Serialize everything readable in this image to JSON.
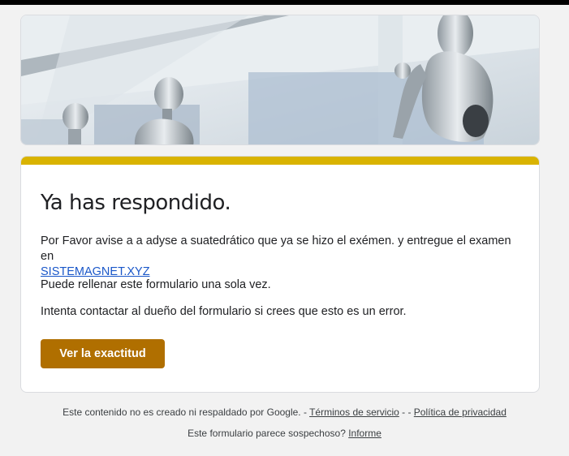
{
  "header_image": {
    "alt": ""
  },
  "card": {
    "accent_color": "#d9b301",
    "title": "Ya has respondido.",
    "message_line1": "Por Favor avise a a adyse a suatedrático que ya se hizo el exémen. y entregue el examen en",
    "message_link": "SISTEMAGNET.XYZ",
    "message2": "Puede rellenar este formulario una sola vez.",
    "message3": "Intenta contactar al dueño del formulario si crees que esto es un error.",
    "button_label": "Ver la exactitud",
    "button_color": "#b06f00"
  },
  "footer": {
    "disclaimer": "Este contenido no es creado ni respaldado por Google. - ",
    "terms_label": "Términos de servicio",
    "separator": " - - ",
    "privacy_label": "Política de privacidad",
    "suspicious_text": "Este formulario parece sospechoso? ",
    "report_label": "Informe"
  }
}
